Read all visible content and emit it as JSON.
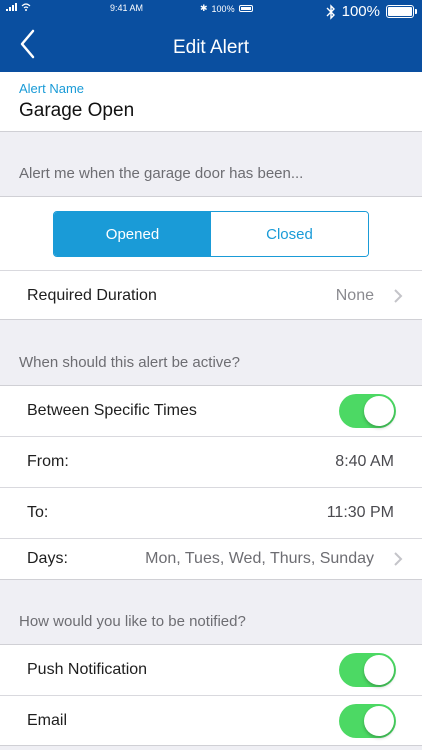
{
  "status_bar": {
    "time_small": "9:41 AM",
    "battery_small": "100%",
    "battery": "100%"
  },
  "header": {
    "title": "Edit Alert",
    "back_icon": "chevron-left-icon",
    "background": "#0a4fa0"
  },
  "alert_name": {
    "label": "Alert Name",
    "value": "Garage Open"
  },
  "trigger_section": {
    "header": "Alert me when the garage door has been...",
    "options": [
      "Opened",
      "Closed"
    ],
    "selected": "Opened",
    "duration": {
      "label": "Required Duration",
      "value": "None"
    }
  },
  "schedule_section": {
    "header": "When should this alert be active?",
    "specific_times": {
      "label": "Between Specific Times",
      "enabled": true
    },
    "from": {
      "label": "From:",
      "value": "8:40 AM"
    },
    "to": {
      "label": "To:",
      "value": "11:30 PM"
    },
    "days": {
      "label": "Days:",
      "value": "Mon, Tues, Wed, Thurs, Sunday"
    }
  },
  "notify_section": {
    "header": "How would you like to be notified?",
    "push": {
      "label": "Push Notification",
      "enabled": true
    },
    "email": {
      "label": "Email",
      "enabled": true
    }
  },
  "colors": {
    "accent": "#1a9bd7",
    "toggle_on": "#4cd964"
  }
}
